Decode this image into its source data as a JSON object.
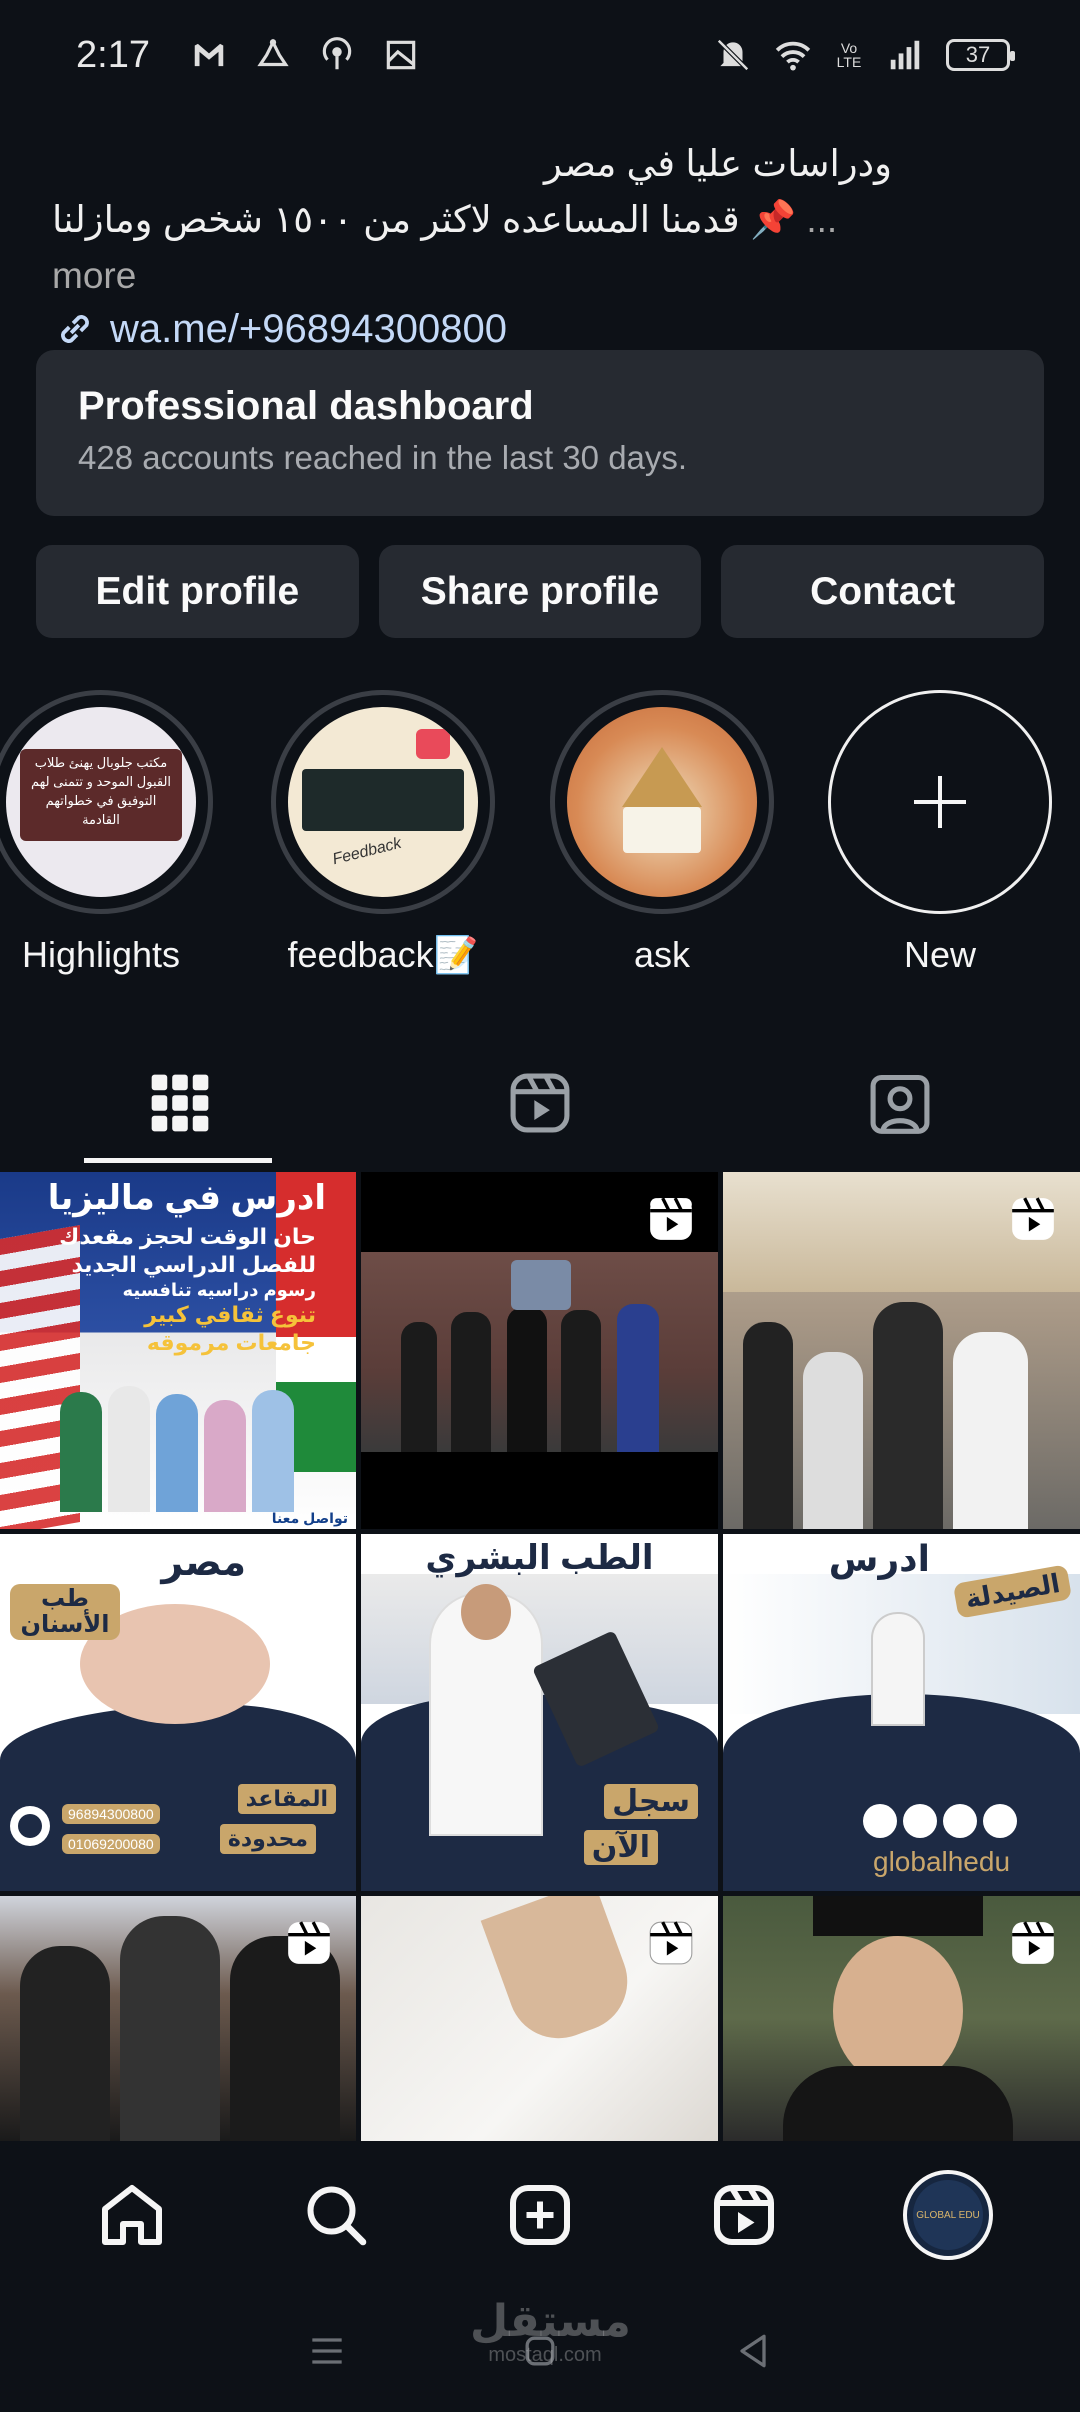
{
  "status_bar": {
    "time": "2:17",
    "battery": "37",
    "left_icons": [
      "gmail-icon",
      "notification-icon",
      "podcast-icon",
      "gallery-icon"
    ],
    "right_icons": [
      "mute-icon",
      "wifi-icon",
      "volte-icon",
      "signal-icon"
    ],
    "volte_label": "Vo LTE"
  },
  "bio": {
    "line2": "ودراسات عليا في مصر",
    "line3": "قدمنا المساعده لاكثر من ١٥٠٠ شخص ومازلنا",
    "more": "... more",
    "pin_emoji": "📌",
    "link": "wa.me/+96894300800"
  },
  "dashboard": {
    "title": "Professional dashboard",
    "subtitle": "428 accounts reached in the last 30 days."
  },
  "buttons": {
    "edit": "Edit profile",
    "share": "Share profile",
    "contact": "Contact"
  },
  "highlights": [
    {
      "label": "Highlights",
      "text": "مكتب جلوبال يهنئ طلاب القبول الموحد و تتمنى لهم التوفيق في خطواتهم القادمة"
    },
    {
      "label": "feedback📝",
      "text": "Feedback"
    },
    {
      "label": "ask"
    },
    {
      "label": "New"
    }
  ],
  "tabs": [
    "grid-icon",
    "reels-icon",
    "tagged-icon"
  ],
  "grid_posts": [
    {
      "type": "image",
      "title": "ادرس في ماليزيا",
      "lines": [
        "حان الوقت لحجز مقعدك",
        "للفصل الدراسي الجديد",
        "رسوم دراسيه تنافسيه",
        "تنوع ثقافي كبير",
        "جامعات مرموقه"
      ],
      "footer": "تواصل معنا"
    },
    {
      "type": "reel"
    },
    {
      "type": "reel"
    },
    {
      "type": "image",
      "title": "مصر",
      "tag": "طب الأسنان",
      "lines": [
        "المقاعد",
        "محدودة"
      ],
      "phones": [
        "96894300800",
        "01069200080"
      ]
    },
    {
      "type": "image",
      "title": "الطب البشري",
      "lines": [
        "سجل",
        "الآن"
      ]
    },
    {
      "type": "image",
      "title": "ادرس",
      "tag": "الصيدلة",
      "handle": "globalhedu"
    },
    {
      "type": "reel"
    },
    {
      "type": "reel"
    },
    {
      "type": "reel"
    }
  ],
  "bottom_nav": [
    "home-icon",
    "search-icon",
    "create-icon",
    "reels-icon",
    "profile-avatar"
  ],
  "avatar_text": "GLOBAL EDU",
  "watermark": {
    "main": "مستقل",
    "sub": "mostaql.com"
  },
  "colors": {
    "background": "#0d1117",
    "card": "#262a31",
    "link": "#c4d9f7",
    "muted": "#a8abb0"
  }
}
